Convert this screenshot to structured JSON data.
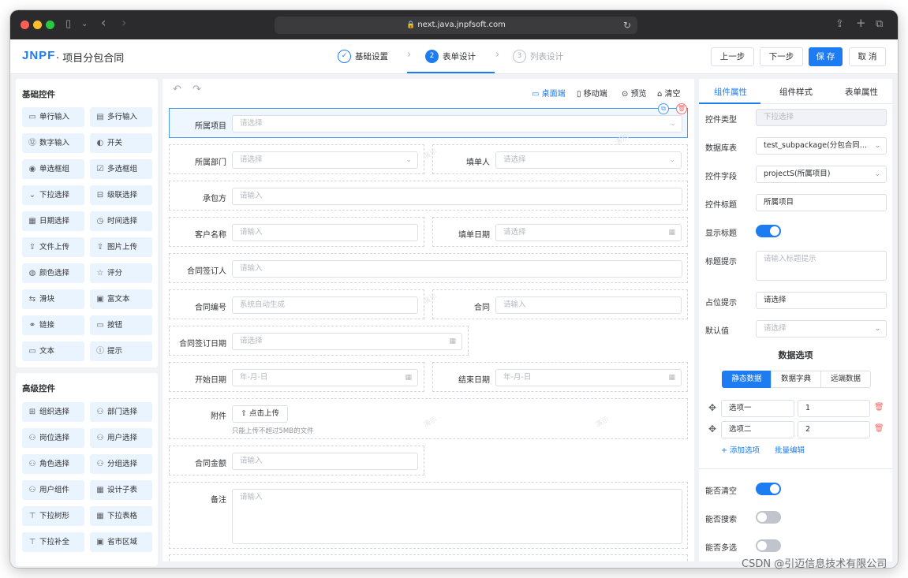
{
  "browser": {
    "url": "next.java.jnpfsoft.com",
    "colors": {
      "close": "#ff5f57",
      "minimize": "#febc2e",
      "zoom": "#28c840"
    }
  },
  "header": {
    "logo": "JNPF",
    "separator": "·",
    "title": "项目分包合同",
    "steps": [
      {
        "num": "✓",
        "label": "基础设置",
        "state": "done"
      },
      {
        "num": "2",
        "label": "表单设计",
        "state": "active"
      },
      {
        "num": "3",
        "label": "列表设计",
        "state": "pending"
      }
    ],
    "buttons": {
      "prev": "上一步",
      "next": "下一步",
      "save": "保 存",
      "cancel": "取 消"
    }
  },
  "left": {
    "basic_title": "基础控件",
    "basic": [
      {
        "icon": "▭",
        "label": "单行输入"
      },
      {
        "icon": "▤",
        "label": "多行输入"
      },
      {
        "icon": "⑫",
        "label": "数字输入"
      },
      {
        "icon": "◐",
        "label": "开关"
      },
      {
        "icon": "◉",
        "label": "单选框组"
      },
      {
        "icon": "☑",
        "label": "多选框组"
      },
      {
        "icon": "⌄",
        "label": "下拉选择"
      },
      {
        "icon": "⊟",
        "label": "级联选择"
      },
      {
        "icon": "▦",
        "label": "日期选择"
      },
      {
        "icon": "◷",
        "label": "时间选择"
      },
      {
        "icon": "⇪",
        "label": "文件上传"
      },
      {
        "icon": "⇪",
        "label": "图片上传"
      },
      {
        "icon": "◍",
        "label": "颜色选择"
      },
      {
        "icon": "☆",
        "label": "评分"
      },
      {
        "icon": "⇆",
        "label": "滑块"
      },
      {
        "icon": "▣",
        "label": "富文本"
      },
      {
        "icon": "⚭",
        "label": "链接"
      },
      {
        "icon": "▭",
        "label": "按钮"
      },
      {
        "icon": "▭",
        "label": "文本"
      },
      {
        "icon": "ⓘ",
        "label": "提示"
      }
    ],
    "advanced_title": "高级控件",
    "advanced": [
      {
        "icon": "⊞",
        "label": "组织选择"
      },
      {
        "icon": "⚇",
        "label": "部门选择"
      },
      {
        "icon": "⚇",
        "label": "岗位选择"
      },
      {
        "icon": "⚇",
        "label": "用户选择"
      },
      {
        "icon": "⚇",
        "label": "角色选择"
      },
      {
        "icon": "⚇",
        "label": "分组选择"
      },
      {
        "icon": "⚇",
        "label": "用户组件"
      },
      {
        "icon": "▦",
        "label": "设计子表"
      },
      {
        "icon": "⊤",
        "label": "下拉树形"
      },
      {
        "icon": "▦",
        "label": "下拉表格"
      },
      {
        "icon": "⊤",
        "label": "下拉补全"
      },
      {
        "icon": "▣",
        "label": "省市区域"
      }
    ]
  },
  "canvas": {
    "toolbar": {
      "undo": "↶",
      "redo": "↷",
      "desktop": "桌面端",
      "mobile": "移动端",
      "preview": "预览",
      "clear": "清空"
    },
    "watermark": "演示",
    "fields": {
      "project": {
        "label": "所属项目",
        "placeholder": "请选择"
      },
      "dept": {
        "label": "所属部门",
        "placeholder": "请选择"
      },
      "filler": {
        "label": "填单人",
        "placeholder": "请选择"
      },
      "contractor": {
        "label": "承包方",
        "placeholder": "请输入"
      },
      "customer": {
        "label": "客户名称",
        "placeholder": "请输入"
      },
      "fill_date": {
        "label": "填单日期",
        "placeholder": "请选择"
      },
      "signer": {
        "label": "合同签订人",
        "placeholder": "请输入"
      },
      "contract_no": {
        "label": "合同编号",
        "placeholder": "系统自动生成"
      },
      "contract": {
        "label": "合同",
        "placeholder": "请输入"
      },
      "sign_date": {
        "label": "合同签订日期",
        "placeholder": "请选择"
      },
      "start_date": {
        "label": "开始日期",
        "placeholder": "年-月-日"
      },
      "end_date": {
        "label": "结束日期",
        "placeholder": "年-月-日"
      },
      "attachment": {
        "label": "附件",
        "button": "点击上传",
        "hint": "只能上传不超过5MB的文件"
      },
      "amount": {
        "label": "合同金额",
        "placeholder": "请输入"
      },
      "remark": {
        "label": "备注",
        "placeholder": "请输入"
      }
    }
  },
  "right": {
    "tabs": [
      "组件属性",
      "组件样式",
      "表单属性"
    ],
    "props": {
      "type": {
        "label": "控件类型",
        "value": "下拉选择"
      },
      "db_table": {
        "label": "数据库表",
        "value": "test_subpackage(分包合同..."
      },
      "field": {
        "label": "控件字段",
        "value": "projectS(所属项目)"
      },
      "title": {
        "label": "控件标题",
        "value": "所属项目"
      },
      "show_title": {
        "label": "显示标题"
      },
      "title_tip": {
        "label": "标题提示",
        "placeholder": "请输入标题提示"
      },
      "placeholder": {
        "label": "占位提示",
        "value": "请选择"
      },
      "default": {
        "label": "默认值",
        "placeholder": "请选择"
      }
    },
    "data_options_title": "数据选项",
    "segments": [
      "静态数据",
      "数据字典",
      "远端数据"
    ],
    "options": [
      {
        "label": "选项一",
        "value": "1"
      },
      {
        "label": "选项二",
        "value": "2"
      }
    ],
    "add_option": "+ 添加选项",
    "batch_edit": "批量编辑",
    "toggles": {
      "clearable": "能否清空",
      "searchable": "能否搜索",
      "multiple": "能否多选"
    },
    "switch_states": {
      "show_title": true,
      "clearable": true,
      "searchable": false,
      "multiple": false
    }
  },
  "footer_watermark": "CSDN @引迈信息技术有限公司",
  "accent": "#1d7cf2"
}
